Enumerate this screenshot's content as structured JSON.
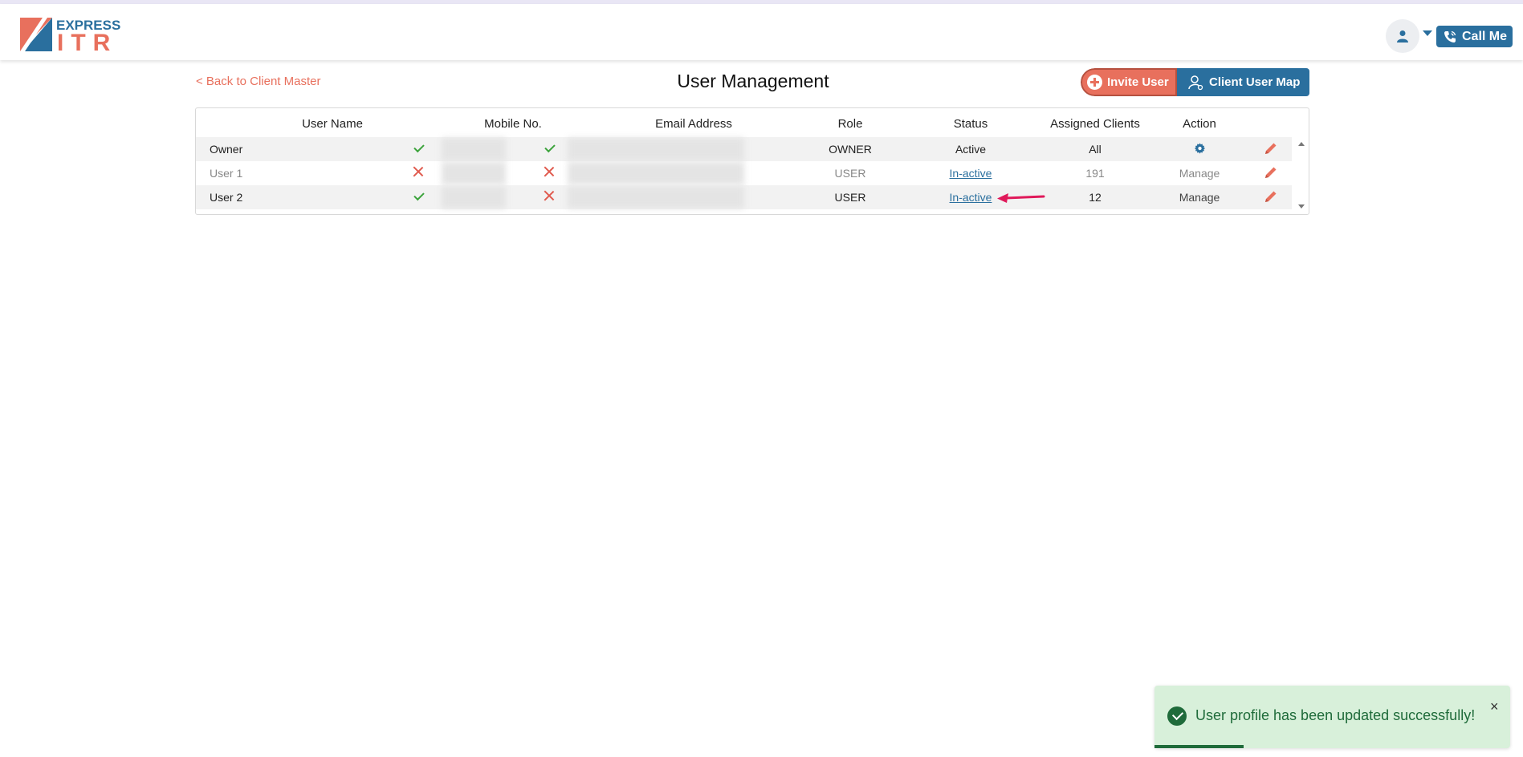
{
  "header": {
    "logo_top": "EXPRESS",
    "logo_bottom": "ITR",
    "call_me_label": "Call Me",
    "icons": [
      "user-avatar-icon",
      "dropdown-caret-icon",
      "phone-icon"
    ]
  },
  "nav": {
    "back_label": "< Back to Client Master"
  },
  "page": {
    "title": "User Management"
  },
  "toolbar": {
    "invite_label": "Invite User",
    "client_map_label": "Client User Map"
  },
  "table": {
    "columns": [
      "User Name",
      "Mobile No.",
      "Email Address",
      "Role",
      "Status",
      "Assigned Clients",
      "Action"
    ],
    "rows": [
      {
        "name": "Owner",
        "mobile_verified": true,
        "email_verified": true,
        "role": "OWNER",
        "status": "Active",
        "assigned": "All",
        "action": "gear-icon"
      },
      {
        "name": "User 1",
        "mobile_verified": false,
        "email_verified": false,
        "role": "USER",
        "status": "In-active",
        "assigned": "191",
        "action": "Manage"
      },
      {
        "name": "User 2",
        "mobile_verified": true,
        "email_verified": false,
        "role": "USER",
        "status": "In-active",
        "assigned": "12",
        "action": "Manage"
      }
    ]
  },
  "toast": {
    "message": "User profile has been updated successfully!",
    "close_label": "×",
    "progress_fraction": 0.25
  },
  "colors": {
    "brand_blue": "#2a6f9e",
    "brand_coral": "#e8705d",
    "success_green": "#1f6b3a",
    "toast_bg": "#d8f0da",
    "annotation_arrow": "#e0195a"
  }
}
